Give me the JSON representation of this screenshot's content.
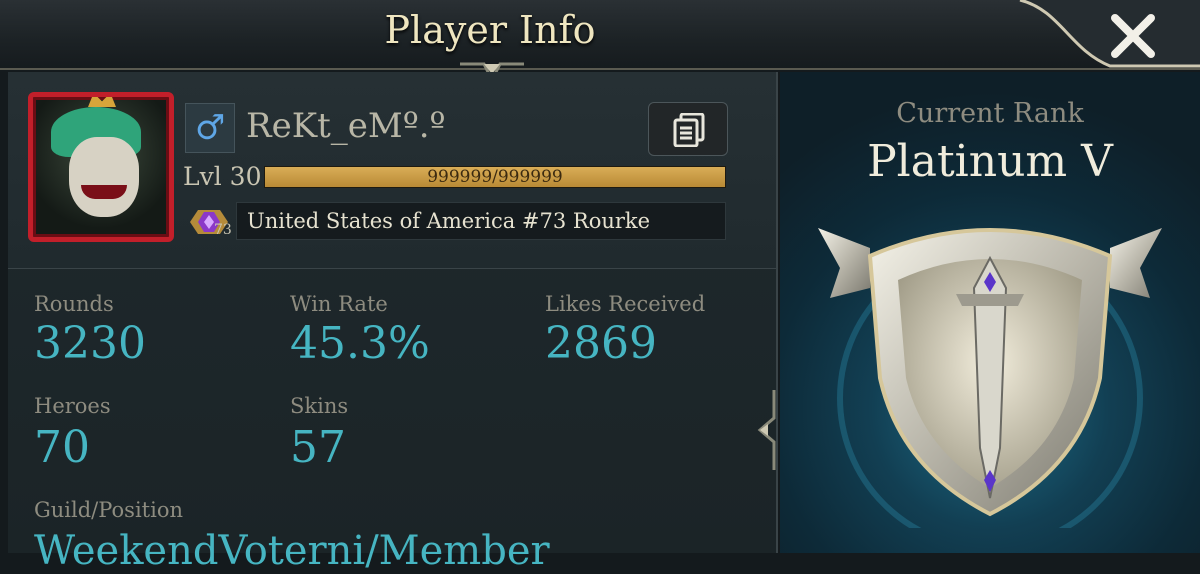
{
  "header": {
    "title": "Player Info"
  },
  "player": {
    "gender_symbol": "♂",
    "name": "ReKt_eMº.º",
    "level_label": "Lvl 30",
    "xp_text": "999999/999999",
    "xp_progress": 1.0,
    "region_badge_number": "73",
    "country_rank_text": "United States of America #73 Rourke"
  },
  "stats": {
    "rounds_label": "Rounds",
    "rounds_value": "3230",
    "win_rate_label": "Win Rate",
    "win_rate_value": "45.3%",
    "likes_label": "Likes Received",
    "likes_value": "2869",
    "heroes_label": "Heroes",
    "heroes_value": "70",
    "skins_label": "Skins",
    "skins_value": "57",
    "guild_label": "Guild/Position",
    "guild_value": "WeekendVoterni/Member"
  },
  "rank": {
    "caption": "Current Rank",
    "name": "Platinum V"
  },
  "colors": {
    "stat_value": "#46b5c2",
    "frame_red": "#c21f2a",
    "xp_gold": "#d9ad57",
    "title_cream": "#efe6c0"
  },
  "icons": {
    "close": "close-icon",
    "copy": "copy-icon",
    "gender": "male-icon",
    "rank_gem": "gem-icon",
    "emblem": "platinum-shield-emblem"
  }
}
